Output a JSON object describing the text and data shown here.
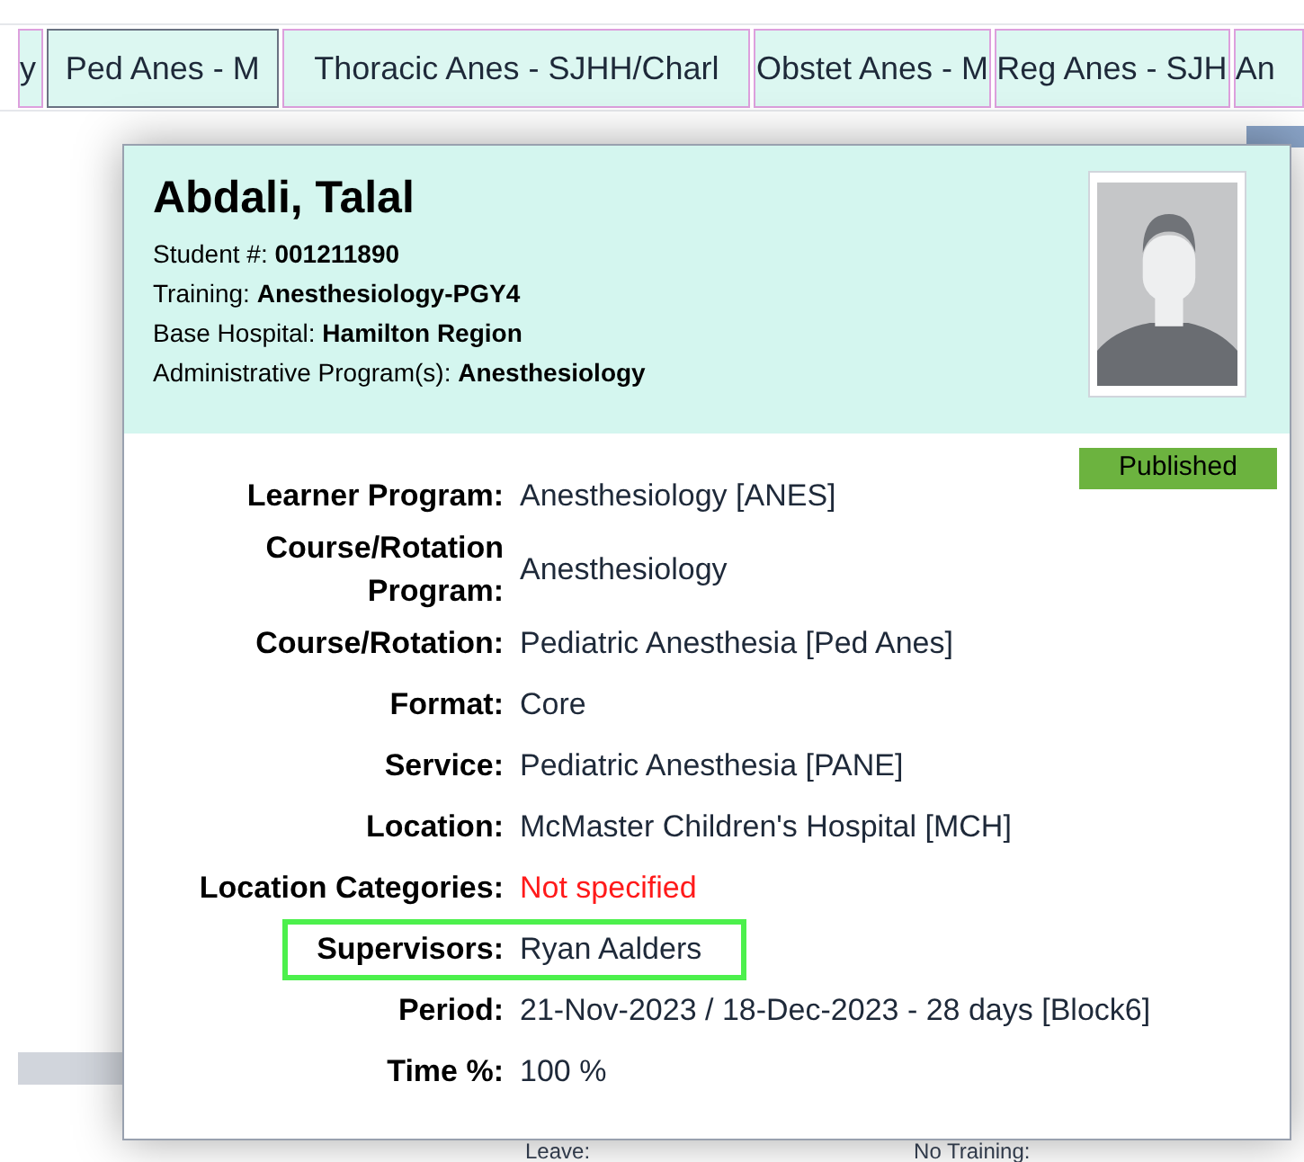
{
  "tabs": [
    {
      "label": "y",
      "selected": false
    },
    {
      "label": "Ped Anes - M",
      "selected": true
    },
    {
      "label": "Thoracic Anes - SJHH/Charl",
      "selected": false
    },
    {
      "label": "Obstet Anes - M",
      "selected": false
    },
    {
      "label": "Reg Anes - SJH",
      "selected": false
    },
    {
      "label": "An",
      "selected": false
    }
  ],
  "popup": {
    "name": "Abdali, Talal",
    "details": [
      {
        "label": "Student #:",
        "value": "001211890"
      },
      {
        "label": "Training:",
        "value": "Anesthesiology-PGY4"
      },
      {
        "label": "Base Hospital:",
        "value": "Hamilton Region"
      },
      {
        "label": "Administrative Program(s):",
        "value": "Anesthesiology"
      }
    ],
    "status_badge": "Published",
    "fields": [
      {
        "label": "Learner Program:",
        "value": "Anesthesiology [ANES]",
        "kind": "normal",
        "highlighted": false
      },
      {
        "label": "Course/Rotation Program:",
        "value": "Anesthesiology",
        "kind": "normal",
        "highlighted": false
      },
      {
        "label": "Course/Rotation:",
        "value": "Pediatric Anesthesia [Ped Anes]",
        "kind": "normal",
        "highlighted": false
      },
      {
        "label": "Format:",
        "value": "Core",
        "kind": "normal",
        "highlighted": false
      },
      {
        "label": "Service:",
        "value": "Pediatric Anesthesia [PANE]",
        "kind": "normal",
        "highlighted": false
      },
      {
        "label": "Location:",
        "value": "McMaster Children's Hospital [MCH]",
        "kind": "normal",
        "highlighted": false
      },
      {
        "label": "Location Categories:",
        "value": "Not specified",
        "kind": "missing",
        "highlighted": false
      },
      {
        "label": "Supervisors:",
        "value": "Ryan Aalders",
        "kind": "normal",
        "highlighted": true
      },
      {
        "label": "Period:",
        "value": "21-Nov-2023 / 18-Dec-2023 - 28 days [Block6]",
        "kind": "normal",
        "highlighted": false
      },
      {
        "label": "Time %:",
        "value": "100 %",
        "kind": "normal",
        "highlighted": false
      }
    ]
  },
  "footer_labels": [
    "Leave:",
    "No Training:"
  ]
}
